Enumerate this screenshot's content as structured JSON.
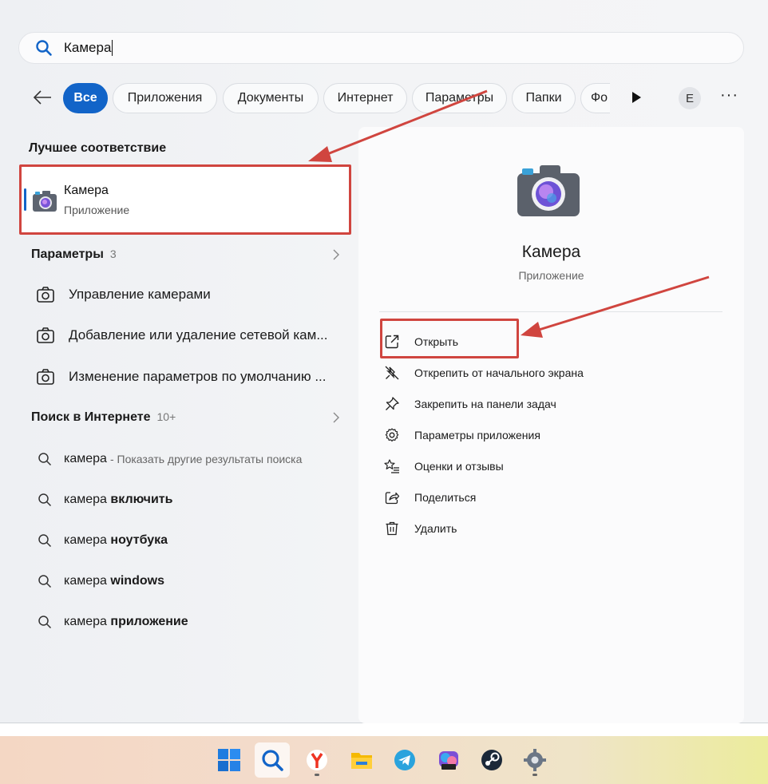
{
  "search": {
    "query": "Камера"
  },
  "filters": {
    "tabs": [
      {
        "label": "Все",
        "active": true
      },
      {
        "label": "Приложения"
      },
      {
        "label": "Документы"
      },
      {
        "label": "Интернет"
      },
      {
        "label": "Параметры"
      },
      {
        "label": "Папки"
      },
      {
        "label": "Фо"
      }
    ],
    "avatar": "E",
    "more": "···"
  },
  "best_match": {
    "section_title": "Лучшее соответствие",
    "name": "Камера",
    "type": "Приложение"
  },
  "settings_group": {
    "title": "Параметры",
    "count": "3",
    "items": [
      "Управление камерами",
      "Добавление или удаление сетевой кам...",
      "Изменение параметров по умолчанию ..."
    ]
  },
  "web_group": {
    "title": "Поиск в Интернете",
    "count": "10+",
    "items": [
      {
        "prefix": "камера",
        "bold": "",
        "hint": "- Показать другие результаты поиска"
      },
      {
        "prefix": "камера",
        "bold": "включить"
      },
      {
        "prefix": "камера",
        "bold": "ноутбука"
      },
      {
        "prefix": "камера",
        "bold": "windows"
      },
      {
        "prefix": "камера",
        "bold": "приложение"
      }
    ]
  },
  "detail": {
    "name": "Камера",
    "type": "Приложение",
    "actions": [
      {
        "label": "Открыть",
        "icon": "open-external-icon"
      },
      {
        "label": "Открепить от начального экрана",
        "icon": "unpin-icon"
      },
      {
        "label": "Закрепить на панели задач",
        "icon": "pin-icon"
      },
      {
        "label": "Параметры приложения",
        "icon": "gear-icon"
      },
      {
        "label": "Оценки и отзывы",
        "icon": "star-list-icon"
      },
      {
        "label": "Поделиться",
        "icon": "share-icon"
      },
      {
        "label": "Удалить",
        "icon": "trash-icon"
      }
    ]
  },
  "taskbar": {
    "icons": [
      "windows-start-icon",
      "search-icon",
      "yandex-browser-icon",
      "file-explorer-icon",
      "telegram-icon",
      "m365-copilot-icon",
      "steam-icon",
      "settings-gear-icon"
    ]
  },
  "colors": {
    "accent": "#1264c8",
    "annotation": "#d0453f"
  }
}
